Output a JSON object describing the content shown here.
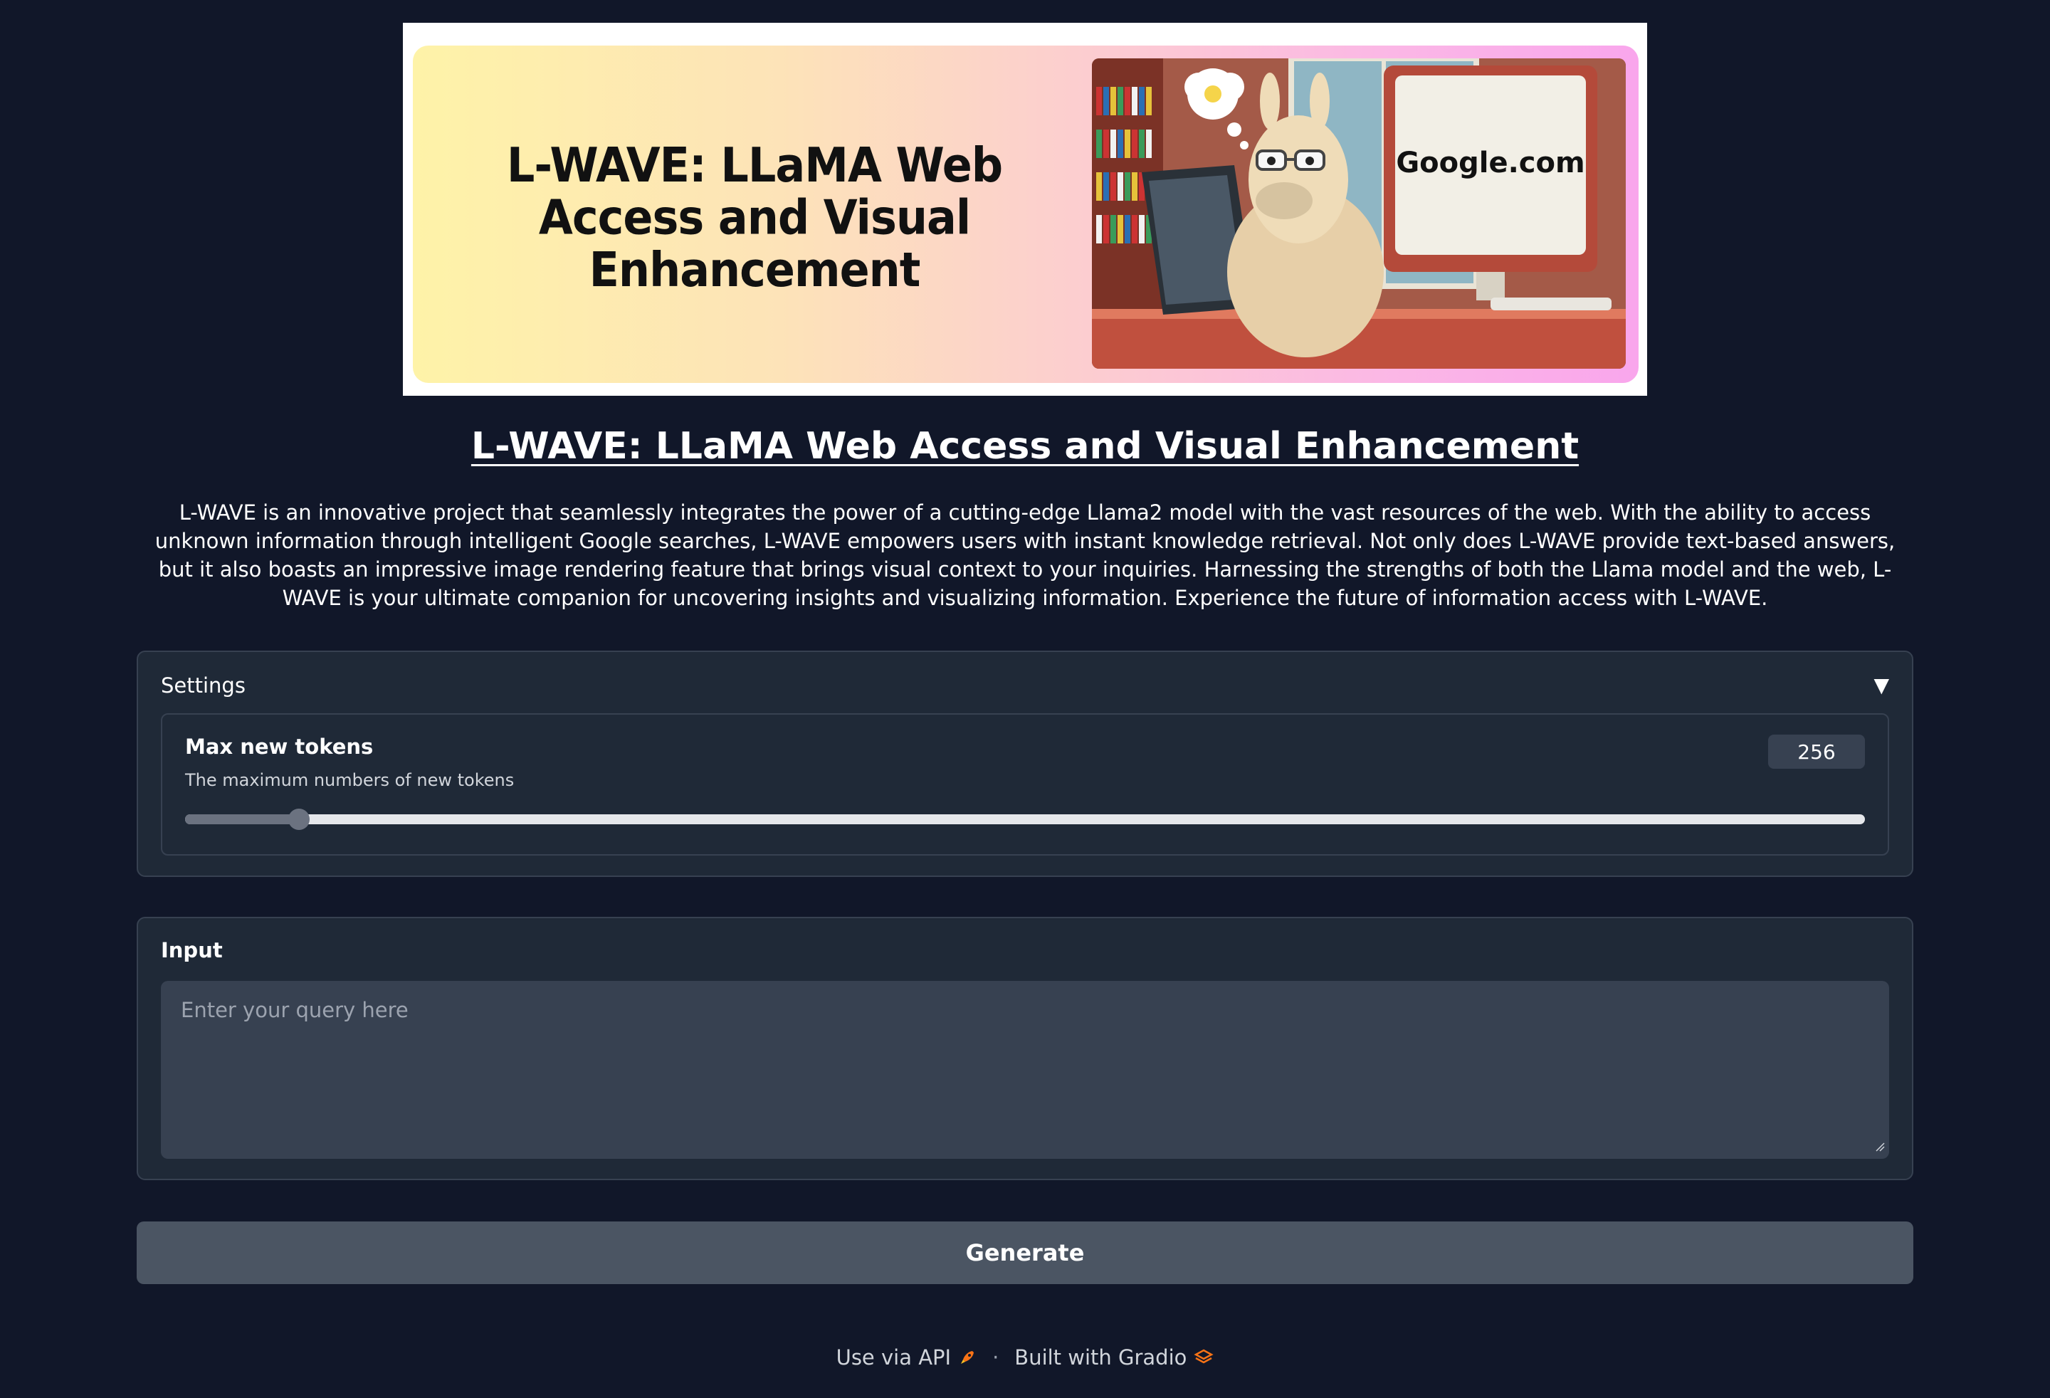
{
  "banner": {
    "title": "L-WAVE: LLaMA Web Access and Visual Enhancement",
    "screen_text": "Google.com"
  },
  "header": {
    "title": "L-WAVE: LLaMA Web Access and Visual Enhancement",
    "description": "L-WAVE is an innovative project that seamlessly integrates the power of a cutting-edge Llama2 model with the vast resources of the web. With the ability to access unknown information through intelligent Google searches, L-WAVE empowers users with instant knowledge retrieval. Not only does L-WAVE provide text-based answers, but it also boasts an impressive image rendering feature that brings visual context to your inquiries. Harnessing the strengths of both the Llama model and the web, L-WAVE is your ultimate companion for uncovering insights and visualizing information. Experience the future of information access with L-WAVE."
  },
  "settings": {
    "title": "Settings",
    "arrow_icon": "triangle-down-icon",
    "max_new_tokens": {
      "label": "Max new tokens",
      "info": "The maximum numbers of new tokens",
      "value": "256",
      "fraction": 0.068
    }
  },
  "input": {
    "label": "Input",
    "placeholder": "Enter your query here",
    "value": ""
  },
  "generate": {
    "label": "Generate"
  },
  "footer": {
    "api_label": "Use via API",
    "api_icon": "rocket-icon",
    "separator": "·",
    "built_label": "Built with Gradio",
    "gradio_icon": "gradio-logo-icon"
  },
  "colors": {
    "background": "#111729",
    "panel": "#1f2937",
    "border": "#374151",
    "button": "#4b5563",
    "accent_orange": "#f97316"
  }
}
